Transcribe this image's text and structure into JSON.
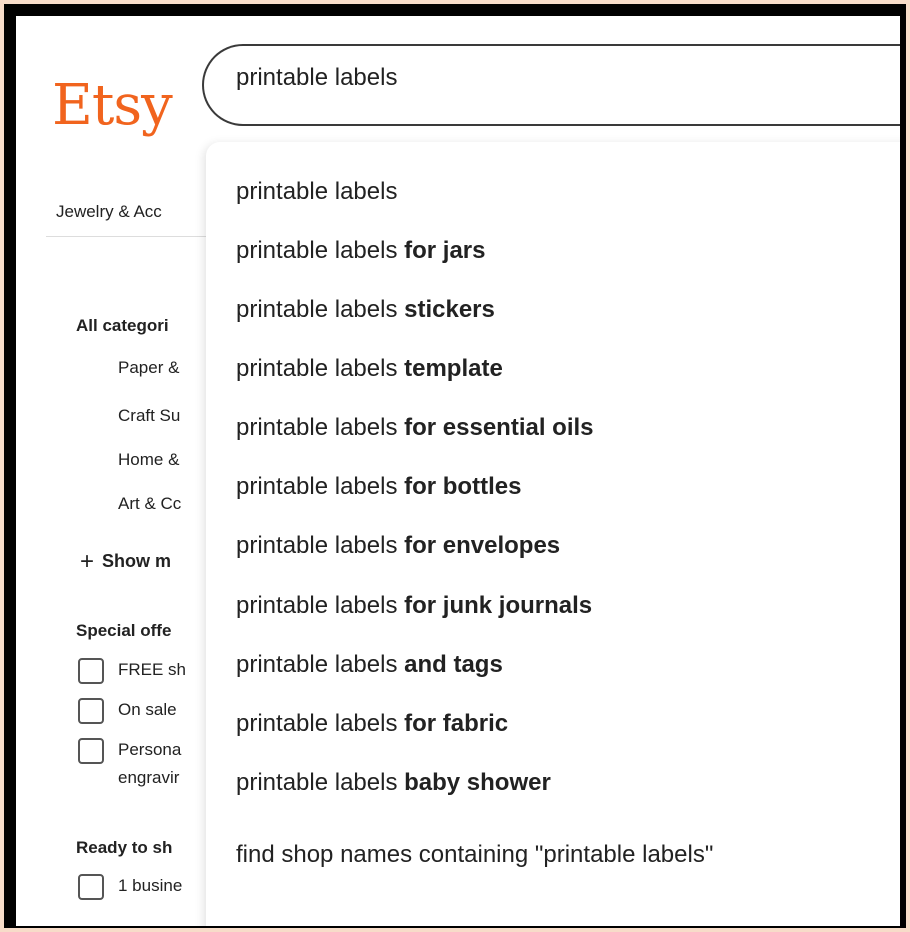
{
  "header": {
    "logo": "Etsy"
  },
  "search": {
    "value": "printable labels"
  },
  "nav": {
    "first_item": "Jewelry & Acc"
  },
  "sidebar": {
    "categories_heading": "All categori",
    "categories": [
      "Paper &",
      "Craft Su",
      "Home &",
      "Art & Cc"
    ],
    "show_more": "Show m",
    "special_offers_heading": "Special offe",
    "offers": [
      "FREE sh",
      "On sale",
      "Persona"
    ],
    "offers_extra": "engravir",
    "ready_heading": "Ready to sh",
    "ready_items": [
      "1 busine"
    ]
  },
  "dropdown": {
    "suggestions": [
      {
        "base": "printable labels",
        "suffix": ""
      },
      {
        "base": "printable labels ",
        "suffix": "for jars"
      },
      {
        "base": "printable labels ",
        "suffix": "stickers"
      },
      {
        "base": "printable labels ",
        "suffix": "template"
      },
      {
        "base": "printable labels ",
        "suffix": "for essential oils"
      },
      {
        "base": "printable labels ",
        "suffix": "for bottles"
      },
      {
        "base": "printable labels ",
        "suffix": "for envelopes"
      },
      {
        "base": "printable labels ",
        "suffix": "for junk journals"
      },
      {
        "base": "printable labels ",
        "suffix": "and tags"
      },
      {
        "base": "printable labels ",
        "suffix": "for fabric"
      },
      {
        "base": "printable labels ",
        "suffix": "baby shower"
      }
    ],
    "shop_search": "find shop names containing \"printable labels\""
  }
}
